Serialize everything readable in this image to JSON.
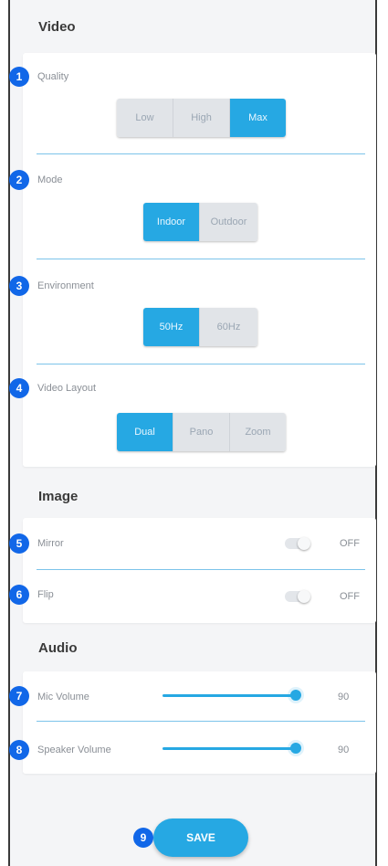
{
  "sections": {
    "video": "Video",
    "image": "Image",
    "audio": "Audio"
  },
  "badges": [
    "1",
    "2",
    "3",
    "4",
    "5",
    "6",
    "7",
    "8",
    "9"
  ],
  "video": {
    "quality": {
      "label": "Quality",
      "options": [
        "Low",
        "High",
        "Max"
      ],
      "selected": "Max"
    },
    "mode": {
      "label": "Mode",
      "options": [
        "Indoor",
        "Outdoor"
      ],
      "selected": "Indoor"
    },
    "environment": {
      "label": "Environment",
      "options": [
        "50Hz",
        "60Hz"
      ],
      "selected": "50Hz"
    },
    "layout": {
      "label": "Video Layout",
      "options": [
        "Dual",
        "Pano",
        "Zoom"
      ],
      "selected": "Dual"
    }
  },
  "image": {
    "mirror": {
      "label": "Mirror",
      "state": "OFF"
    },
    "flip": {
      "label": "Flip",
      "state": "OFF"
    }
  },
  "audio": {
    "mic": {
      "label": "Mic Volume",
      "value": "90"
    },
    "speaker": {
      "label": "Speaker Volume",
      "value": "90"
    }
  },
  "save_label": "SAVE",
  "colors": {
    "accent": "#26a8e3",
    "badge": "#1167e8",
    "inactive_segment": "#e1e4e8"
  }
}
